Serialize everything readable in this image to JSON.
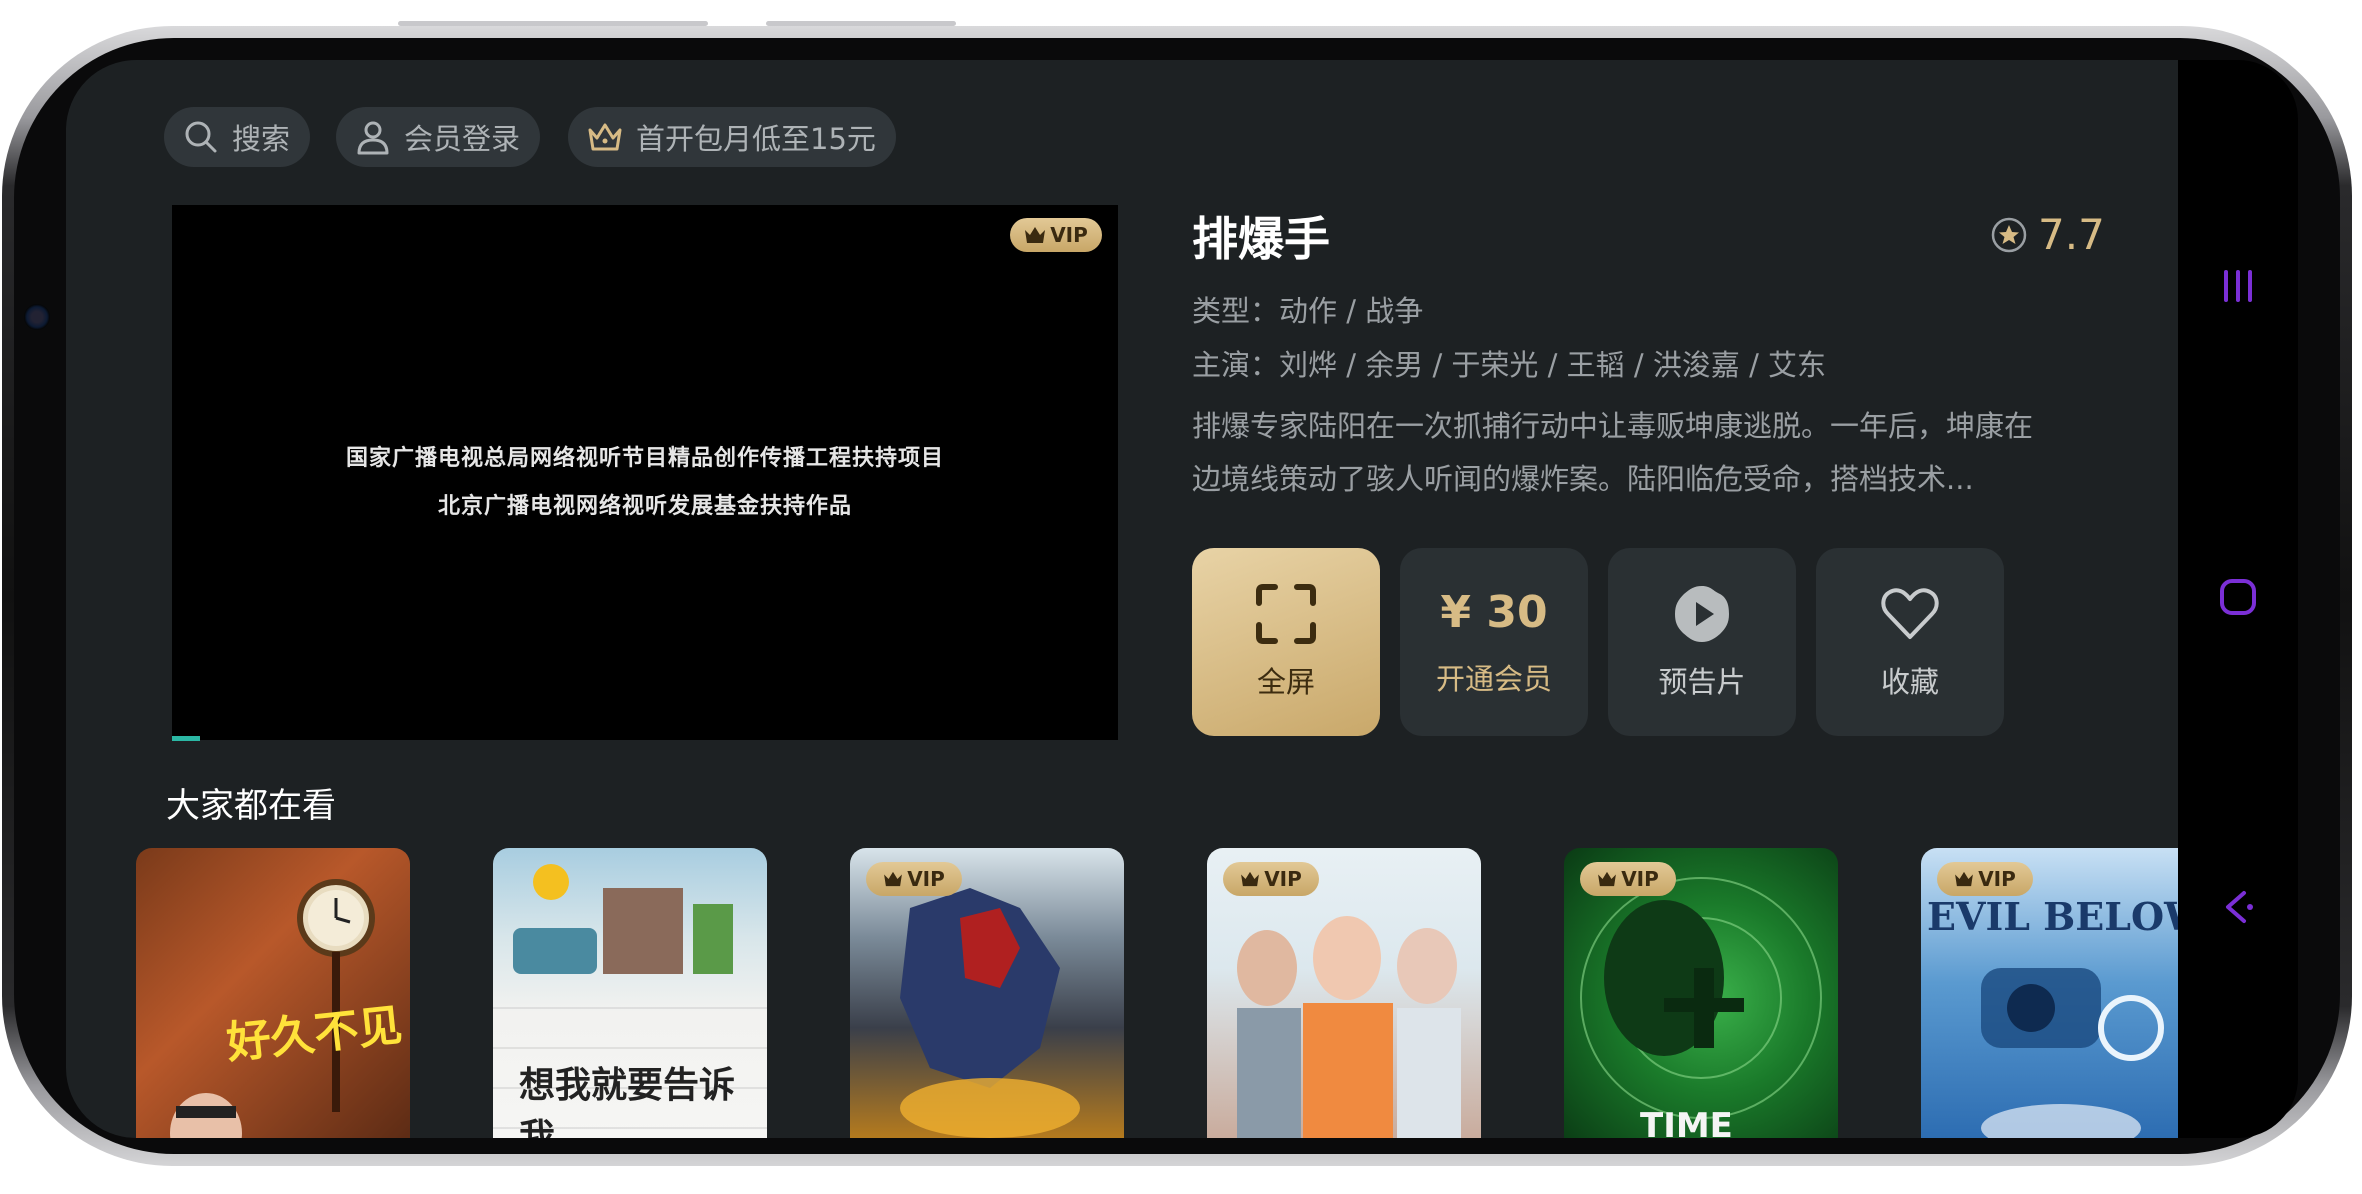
{
  "topbar": {
    "search_label": "搜索",
    "login_label": "会员登录",
    "promo_label": "首开包月低至15元"
  },
  "player": {
    "vip_badge": "VIP",
    "line1": "国家广播电视总局网络视听节目精品创作传播工程扶持项目",
    "line2": "北京广播电视网络视听发展基金扶持作品",
    "progress_fraction": 0.03
  },
  "movie": {
    "title": "排爆手",
    "rating": "7.7",
    "genre_label": "类型：",
    "genre": "动作 / 战争",
    "cast_label": "主演：",
    "cast": "刘烨 / 余男 / 于荣光 / 王韬 / 洪浚嘉 / 艾东",
    "description_line1": "排爆专家陆阳在一次抓捕行动中让毒贩坤康逃脱。一年后，坤康在",
    "description_line2": "边境线策动了骇人听闻的爆炸案。陆阳临危受命，搭档技术..."
  },
  "actions": {
    "fullscreen": "全屏",
    "price": "¥ 30",
    "membership": "开通会员",
    "trailer": "预告片",
    "favorite": "收藏"
  },
  "section": {
    "title": "大家都在看"
  },
  "posters": [
    {
      "vip": false,
      "text": "好久不见"
    },
    {
      "vip": false,
      "text": "想我就要告诉我"
    },
    {
      "vip": true,
      "badge": "VIP",
      "text": ""
    },
    {
      "vip": true,
      "badge": "VIP",
      "text": ""
    },
    {
      "vip": true,
      "badge": "VIP",
      "text": "TIME"
    },
    {
      "vip": true,
      "badge": "VIP",
      "text": "EVIL BELOW"
    }
  ],
  "colors": {
    "background": "#1d2123",
    "accent_gold": "#d7bb85",
    "progress": "#2bb7a4",
    "nav_purple": "#7b2fd6"
  }
}
